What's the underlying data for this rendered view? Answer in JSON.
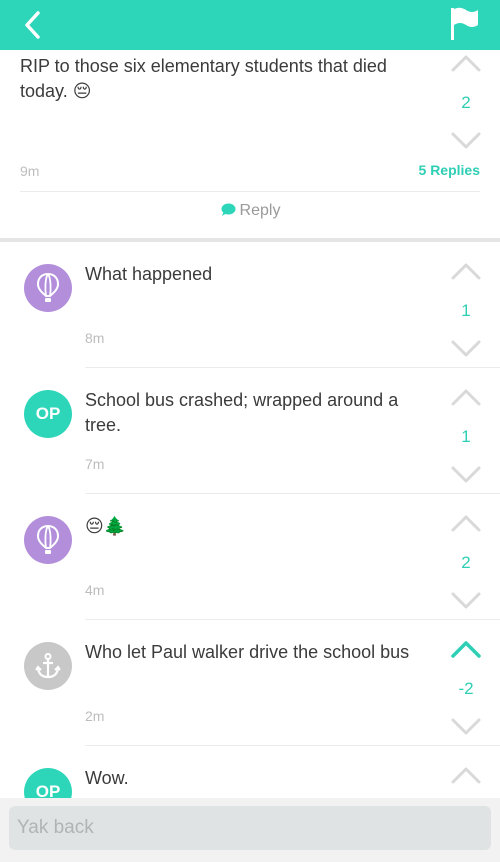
{
  "post": {
    "text": "RIP to those six elementary students that died today.",
    "emoji": "😔",
    "votes": "2",
    "time": "9m",
    "replies_label": "5 Replies",
    "reply_label": "Reply"
  },
  "comments": [
    {
      "avatar": "balloon-icon",
      "text": "What happened",
      "time": "8m",
      "votes": "1"
    },
    {
      "avatar": "OP",
      "text": "School bus crashed; wrapped around a tree.",
      "time": "7m",
      "votes": "1"
    },
    {
      "avatar": "balloon-icon",
      "text": "😔🌲",
      "time": "4m",
      "votes": "2"
    },
    {
      "avatar": "anchor-icon",
      "text": "Who let Paul walker drive the school bus",
      "time": "2m",
      "votes": "-2"
    },
    {
      "avatar": "OP",
      "text": "Wow."
    }
  ],
  "input": {
    "placeholder": "Yak back"
  },
  "colors": {
    "accent": "#2ed6b9",
    "purple_avatar": "#b38fdb",
    "gray_avatar": "#c8c8c8"
  }
}
